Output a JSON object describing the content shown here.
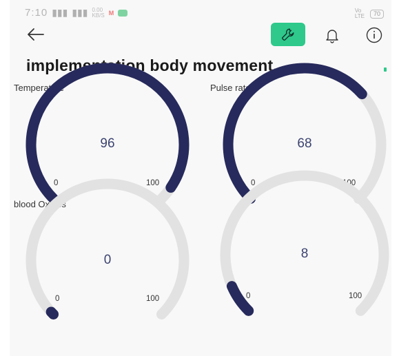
{
  "status_bar": {
    "time": "7:10",
    "net_speed": "0.00\nKB/S",
    "mail_icon": "gmail-icon",
    "volte": "Vo\nLTE",
    "battery": "70"
  },
  "toolbar": {
    "back_icon": "arrow-left-icon",
    "settings_icon": "wrench-icon",
    "notifications_icon": "bell-icon",
    "info_icon": "info-icon",
    "accent": "#2ec98b"
  },
  "page": {
    "title": "implementation body movement..."
  },
  "gauges": [
    {
      "label": "Temperature",
      "value": "96",
      "min": "0",
      "max": "100",
      "fraction": 0.96
    },
    {
      "label": "Pulse rate",
      "value": "68",
      "min": "0",
      "max": "100",
      "fraction": 0.68
    },
    {
      "label": "blood Oxides",
      "value": "0",
      "min": "0",
      "max": "100",
      "fraction": 0.0
    },
    {
      "label": "",
      "value": "8",
      "min": "0",
      "max": "100",
      "fraction": 0.08
    }
  ],
  "colors": {
    "gauge_fill": "#272a5c",
    "gauge_track": "#e2e2e2",
    "value_text": "#3c4370"
  }
}
